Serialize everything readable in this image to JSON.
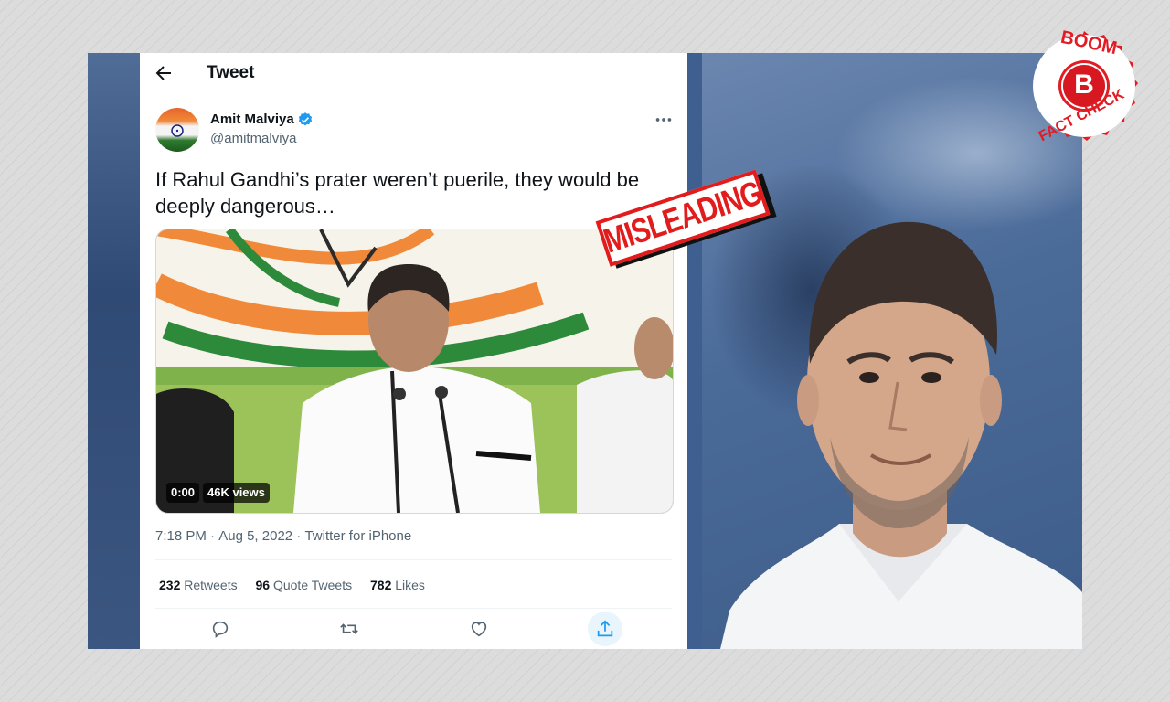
{
  "tweet": {
    "header_title": "Tweet",
    "author_name": "Amit Malviya",
    "author_handle": "@amitmalviya",
    "text": "If Rahul Gandhi’s prater weren’t puerile, they would be deeply dangerous…",
    "video_time": "0:00",
    "video_views": "46K views",
    "time": "7:18 PM",
    "date": "Aug 5, 2022",
    "source": "Twitter for iPhone",
    "separator": "·",
    "retweets_count": "232",
    "retweets_label": "Retweets",
    "quote_count": "96",
    "quote_label": "Quote Tweets",
    "likes_count": "782",
    "likes_label": "Likes"
  },
  "overlay": {
    "stamp_text": "MISLEADING",
    "logo_top": "BOOM",
    "logo_letter": "B",
    "logo_bottom": "FACT CHECK"
  },
  "icons": [
    "back-arrow-icon",
    "verified-badge-icon",
    "more-options-icon",
    "reply-icon",
    "retweet-icon",
    "like-icon",
    "share-icon"
  ],
  "colors": {
    "accent": "#1d9bf0",
    "stamp_red": "#e21c1c",
    "text_primary": "#0f1419",
    "text_secondary": "#536471"
  }
}
